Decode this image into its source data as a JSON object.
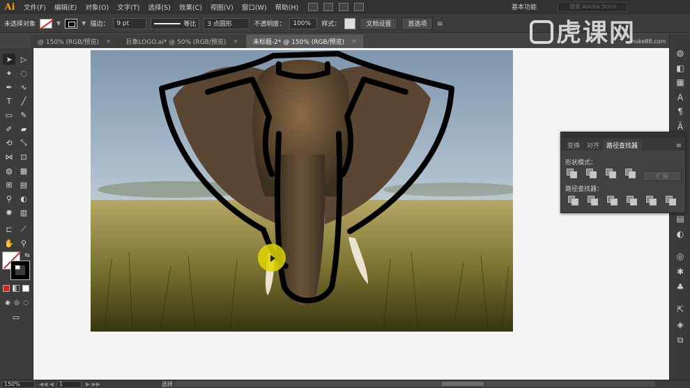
{
  "app": {
    "logo": "Ai"
  },
  "menu": [
    "文件(F)",
    "编辑(E)",
    "对象(O)",
    "文字(T)",
    "选择(S)",
    "效果(C)",
    "视图(V)",
    "窗口(W)",
    "帮助(H)"
  ],
  "workspace": "基本功能",
  "stock_search": {
    "placeholder": "搜索 Adobe Stock"
  },
  "control": {
    "selection_label": "未选择对象",
    "stroke_label": "描边：",
    "stroke_weight": "9 pt",
    "profile_label": "等比",
    "brush_label": "3 点圆形",
    "opacity_label": "不透明度：",
    "opacity_value": "100%",
    "style_label": "样式：",
    "doc_setup": "文档设置",
    "prefs": "首选项"
  },
  "tabs": [
    {
      "label": "@ 150% (RGB/预览)",
      "active": false
    },
    {
      "label": "巨象LOGO.ai* @ 50% (RGB/预览)",
      "active": false
    },
    {
      "label": "未标题-2* @ 150% (RGB/预览)",
      "active": true
    }
  ],
  "panel": {
    "tabs": [
      "变换",
      "对齐",
      "路径查找器"
    ],
    "active_tab": "路径查找器",
    "shape_modes_label": "形状模式：",
    "pathfinders_label": "路径查找器：",
    "expand_label": "扩展"
  },
  "status": {
    "zoom": "150%",
    "page": "1",
    "tool": "选择"
  },
  "watermark": {
    "text": "虎课网",
    "url": "huke88.com"
  },
  "colors": {
    "menubar": "#323232",
    "panel": "#424242",
    "accent_orange": "#ff9a00",
    "outline": "#000000",
    "cursor": "#e1d700"
  }
}
